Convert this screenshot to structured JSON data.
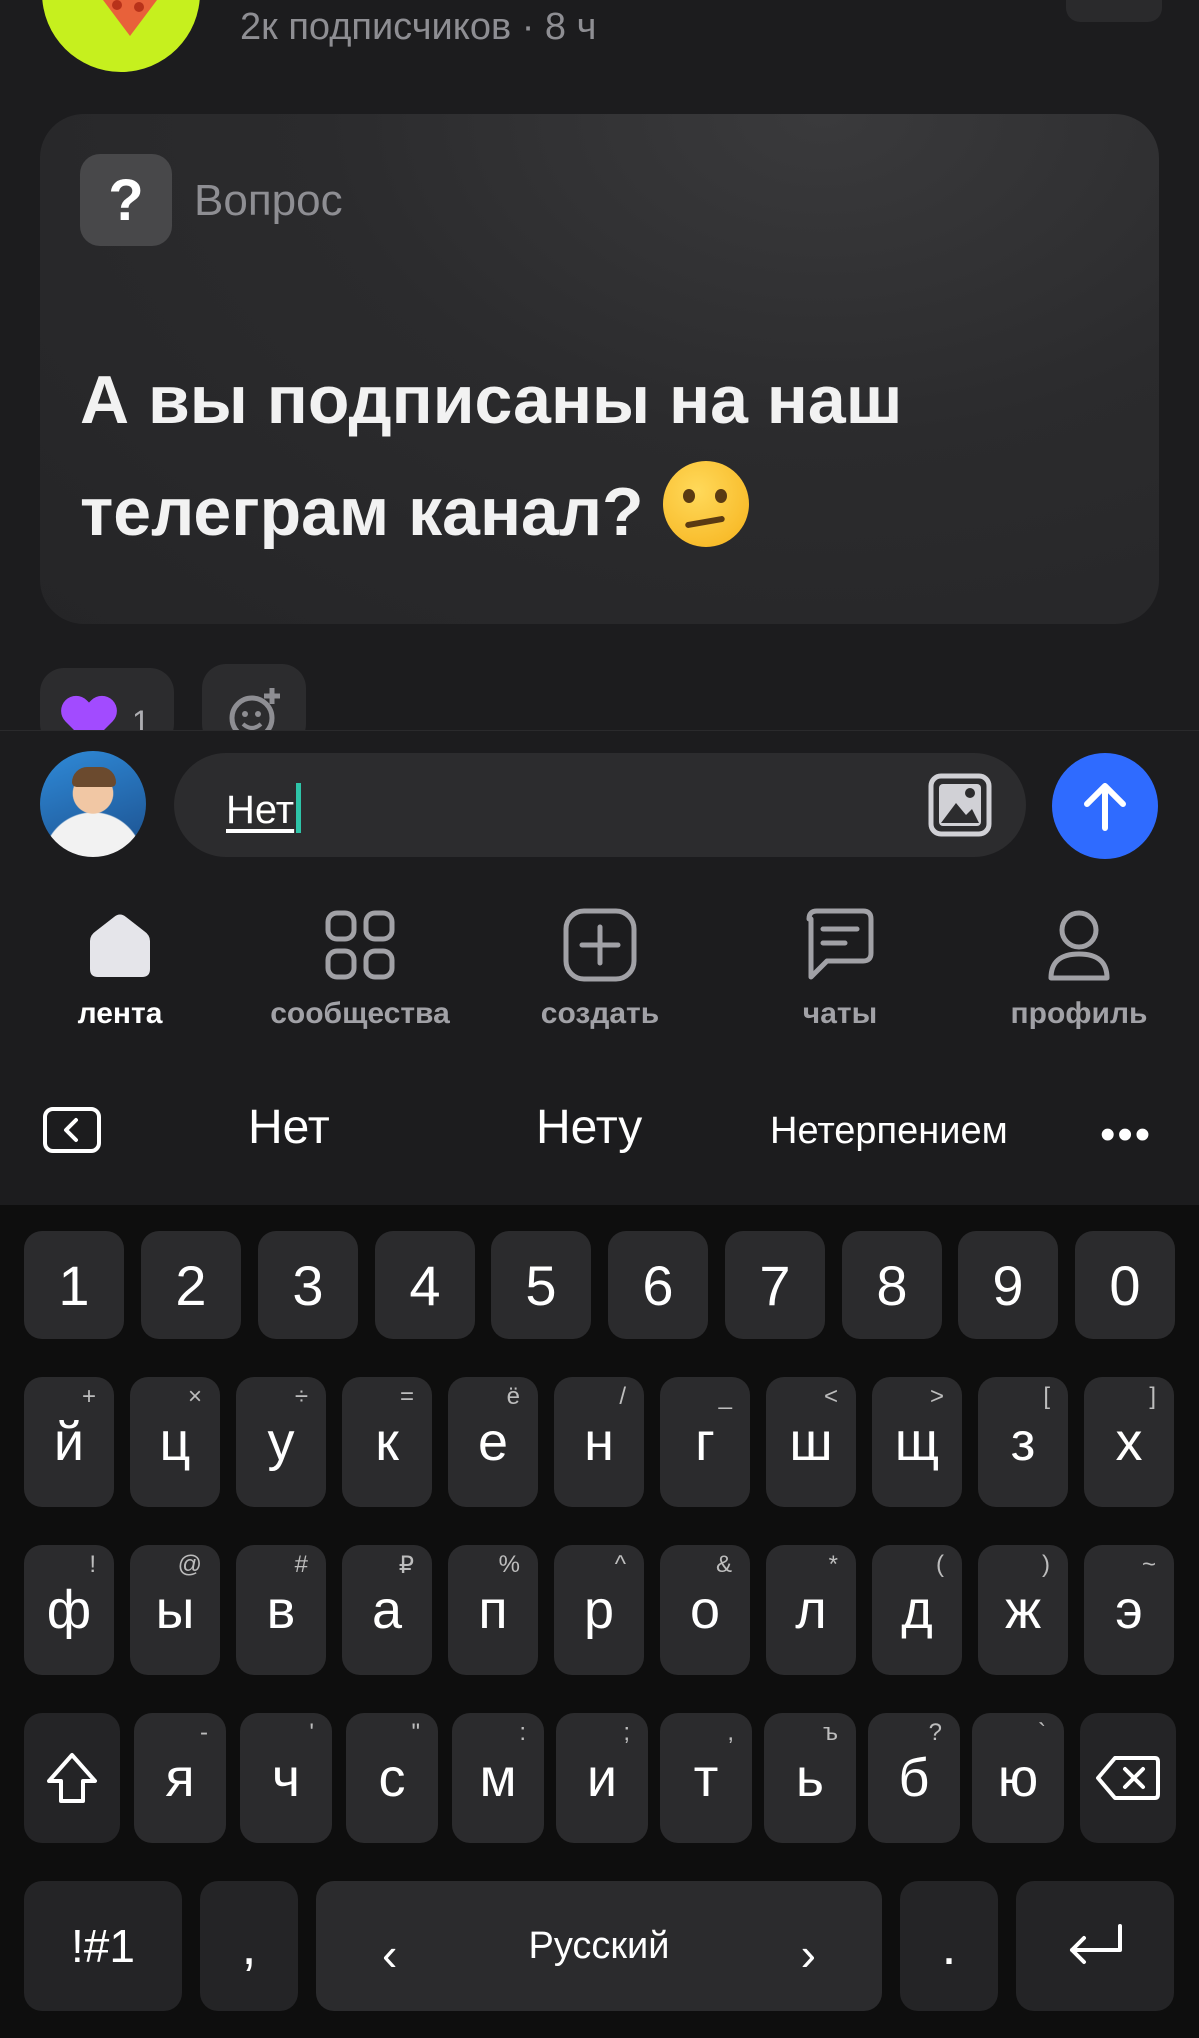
{
  "feed": {
    "meta": "2к подписчиков · 8 ч",
    "post": {
      "type_label": "Вопрос",
      "badge": "?",
      "text_line1": "А вы подписаны на наш",
      "text_line2": "телеграм канал?",
      "emoji": "thinking-face"
    },
    "reactions": {
      "count": "1"
    }
  },
  "composer": {
    "input_value": "Нет",
    "image_button": "image-icon",
    "send_button": "arrow-up-icon"
  },
  "nav": {
    "items": [
      {
        "label": "лента",
        "icon": "home-icon"
      },
      {
        "label": "сообщества",
        "icon": "grid-icon"
      },
      {
        "label": "создать",
        "icon": "plus-square-icon"
      },
      {
        "label": "чаты",
        "icon": "chat-icon"
      },
      {
        "label": "профиль",
        "icon": "user-icon"
      }
    ]
  },
  "suggestions": [
    "Нет",
    "Нету",
    "Нетерпением"
  ],
  "keyboard": {
    "numbers": [
      "1",
      "2",
      "3",
      "4",
      "5",
      "6",
      "7",
      "8",
      "9",
      "0"
    ],
    "row1": [
      [
        "й",
        "+"
      ],
      [
        "ц",
        "×"
      ],
      [
        "у",
        "÷"
      ],
      [
        "к",
        "="
      ],
      [
        "е",
        "ё"
      ],
      [
        "н",
        "/"
      ],
      [
        "г",
        "_"
      ],
      [
        "ш",
        "<"
      ],
      [
        "щ",
        ">"
      ],
      [
        "з",
        "["
      ],
      [
        "х",
        "]"
      ]
    ],
    "row2": [
      [
        "ф",
        "!"
      ],
      [
        "ы",
        "@"
      ],
      [
        "в",
        "#"
      ],
      [
        "а",
        "₽"
      ],
      [
        "п",
        "%"
      ],
      [
        "р",
        "^"
      ],
      [
        "о",
        "&"
      ],
      [
        "л",
        "*"
      ],
      [
        "д",
        "("
      ],
      [
        "ж",
        ")"
      ],
      [
        "э",
        "~"
      ]
    ],
    "row3": [
      [
        "я",
        "-"
      ],
      [
        "ч",
        "'"
      ],
      [
        "с",
        "\""
      ],
      [
        "м",
        ":"
      ],
      [
        "и",
        ";"
      ],
      [
        "т",
        ","
      ],
      [
        "ь",
        "ъ"
      ],
      [
        "б",
        "?"
      ],
      [
        "ю",
        "`"
      ]
    ],
    "symbols_key": "!#1",
    "comma_key": ",",
    "space_label": "Русский",
    "space_left": "‹",
    "space_right": "›",
    "period_key": "."
  }
}
